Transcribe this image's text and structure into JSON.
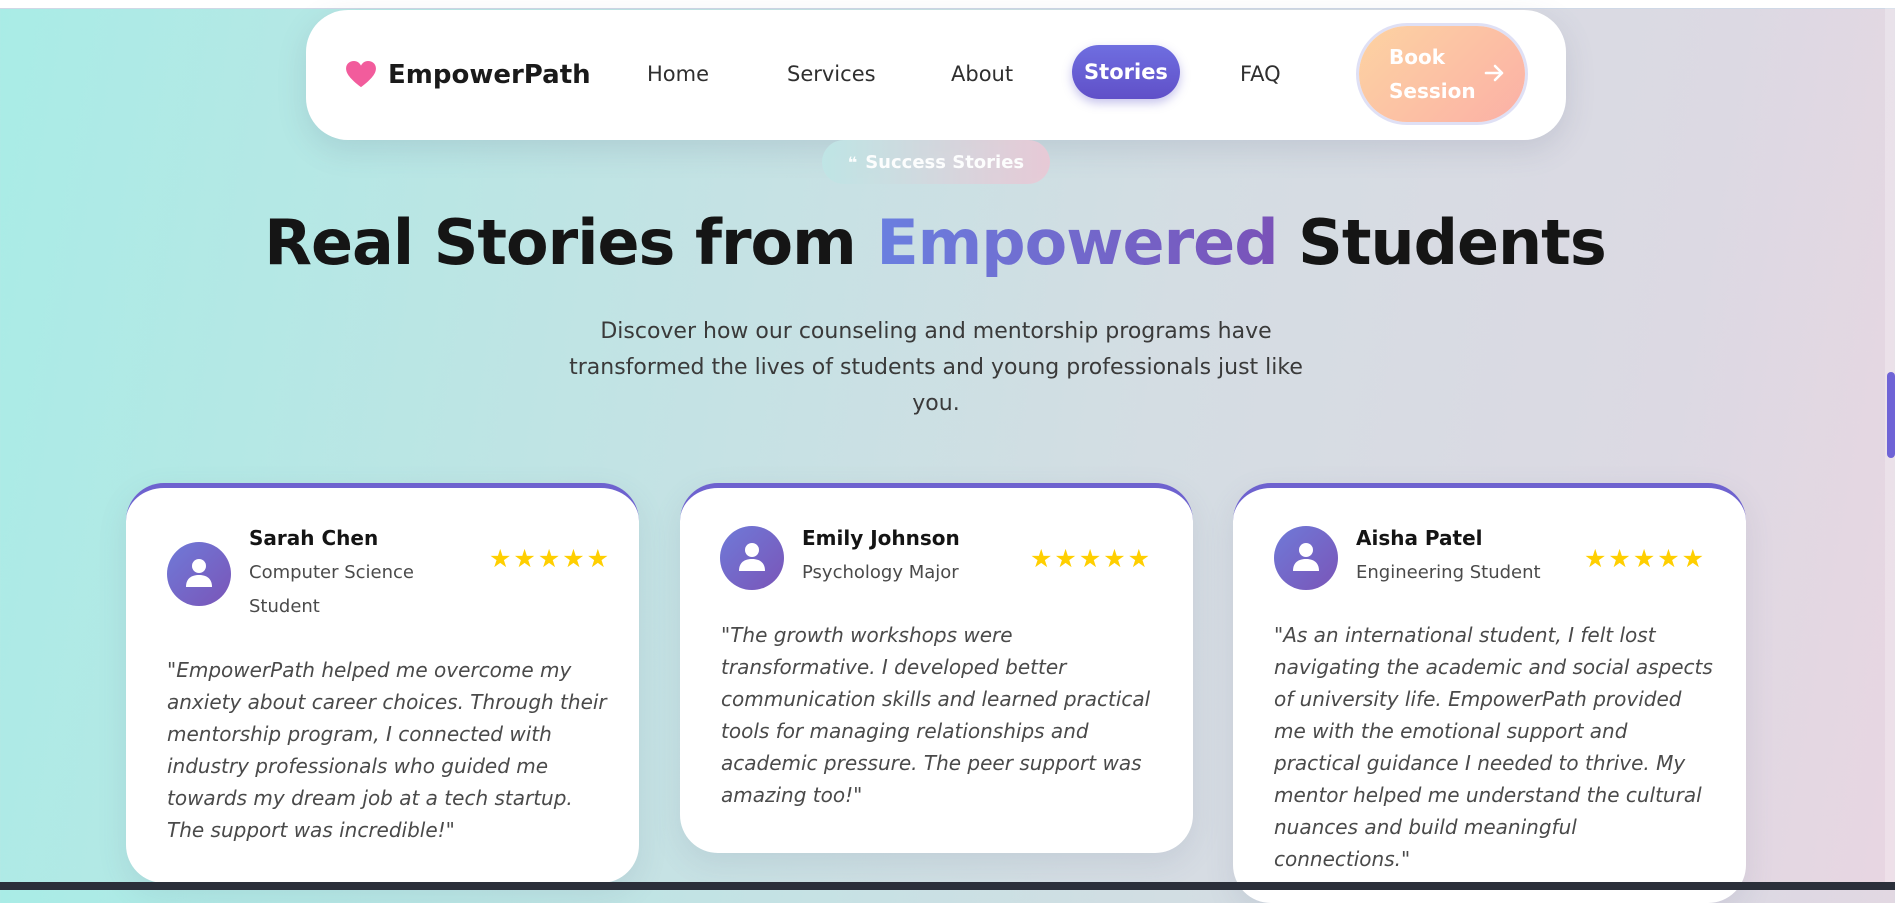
{
  "nav": {
    "logo_text": "EmpowerPath",
    "links": [
      "Home",
      "Services",
      "About",
      "Stories",
      "FAQ"
    ],
    "active": "Stories",
    "cta_label": "Book Session"
  },
  "hero": {
    "badge": "Success Stories",
    "title_prefix": "Real Stories from ",
    "title_accent": "Empowered",
    "title_suffix": " Students",
    "subtitle": "Discover how our counseling and mentorship programs have transformed the lives of students and young professionals just like you."
  },
  "testimonials": [
    {
      "name": "Sarah Chen",
      "role": "Computer Science Student",
      "rating": 5,
      "stars": "★★★★★",
      "quote": "\"EmpowerPath helped me overcome my anxiety about career choices. Through their mentorship program, I connected with industry professionals who guided me towards my dream job at a tech startup. The support was incredible!\""
    },
    {
      "name": "Emily Johnson",
      "role": "Psychology Major",
      "rating": 5,
      "stars": "★★★★★",
      "quote": "\"The growth workshops were transformative. I developed better communication skills and learned practical tools for managing relationships and academic pressure. The peer support was amazing too!\""
    },
    {
      "name": "Aisha Patel",
      "role": "Engineering Student",
      "rating": 5,
      "stars": "★★★★★",
      "quote": "\"As an international student, I felt lost navigating the academic and social aspects of university life. EmpowerPath provided me with the emotional support and practical guidance I needed to thrive. My mentor helped me understand the cultural nuances and build meaningful connections.\""
    }
  ],
  "icons": {
    "logo": "heart-icon",
    "cta": "arrow-right-icon",
    "badge": "quote-icon",
    "avatar": "user-icon",
    "rating": "star-icon"
  },
  "colors": {
    "accent": "#6f63d6",
    "heart": "#f25c9c",
    "star": "#ffcf00",
    "cta_from": "#fdd3a2",
    "cta_to": "#fbb0a6"
  }
}
